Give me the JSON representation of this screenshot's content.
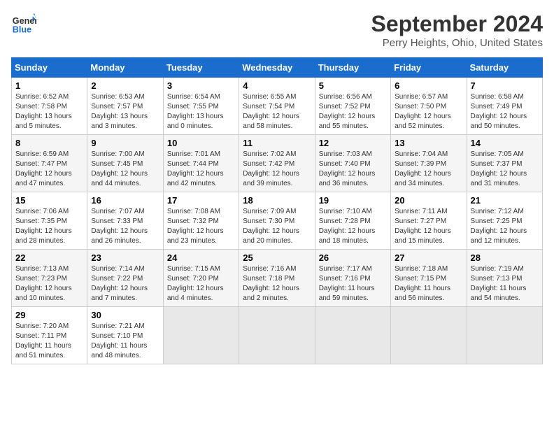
{
  "logo": {
    "line1": "General",
    "line2": "Blue"
  },
  "title": "September 2024",
  "subtitle": "Perry Heights, Ohio, United States",
  "days_of_week": [
    "Sunday",
    "Monday",
    "Tuesday",
    "Wednesday",
    "Thursday",
    "Friday",
    "Saturday"
  ],
  "weeks": [
    [
      {
        "day": 1,
        "sunrise": "6:52 AM",
        "sunset": "7:58 PM",
        "daylight": "13 hours and 5 minutes."
      },
      {
        "day": 2,
        "sunrise": "6:53 AM",
        "sunset": "7:57 PM",
        "daylight": "13 hours and 3 minutes."
      },
      {
        "day": 3,
        "sunrise": "6:54 AM",
        "sunset": "7:55 PM",
        "daylight": "13 hours and 0 minutes."
      },
      {
        "day": 4,
        "sunrise": "6:55 AM",
        "sunset": "7:54 PM",
        "daylight": "12 hours and 58 minutes."
      },
      {
        "day": 5,
        "sunrise": "6:56 AM",
        "sunset": "7:52 PM",
        "daylight": "12 hours and 55 minutes."
      },
      {
        "day": 6,
        "sunrise": "6:57 AM",
        "sunset": "7:50 PM",
        "daylight": "12 hours and 52 minutes."
      },
      {
        "day": 7,
        "sunrise": "6:58 AM",
        "sunset": "7:49 PM",
        "daylight": "12 hours and 50 minutes."
      }
    ],
    [
      {
        "day": 8,
        "sunrise": "6:59 AM",
        "sunset": "7:47 PM",
        "daylight": "12 hours and 47 minutes."
      },
      {
        "day": 9,
        "sunrise": "7:00 AM",
        "sunset": "7:45 PM",
        "daylight": "12 hours and 44 minutes."
      },
      {
        "day": 10,
        "sunrise": "7:01 AM",
        "sunset": "7:44 PM",
        "daylight": "12 hours and 42 minutes."
      },
      {
        "day": 11,
        "sunrise": "7:02 AM",
        "sunset": "7:42 PM",
        "daylight": "12 hours and 39 minutes."
      },
      {
        "day": 12,
        "sunrise": "7:03 AM",
        "sunset": "7:40 PM",
        "daylight": "12 hours and 36 minutes."
      },
      {
        "day": 13,
        "sunrise": "7:04 AM",
        "sunset": "7:39 PM",
        "daylight": "12 hours and 34 minutes."
      },
      {
        "day": 14,
        "sunrise": "7:05 AM",
        "sunset": "7:37 PM",
        "daylight": "12 hours and 31 minutes."
      }
    ],
    [
      {
        "day": 15,
        "sunrise": "7:06 AM",
        "sunset": "7:35 PM",
        "daylight": "12 hours and 28 minutes."
      },
      {
        "day": 16,
        "sunrise": "7:07 AM",
        "sunset": "7:33 PM",
        "daylight": "12 hours and 26 minutes."
      },
      {
        "day": 17,
        "sunrise": "7:08 AM",
        "sunset": "7:32 PM",
        "daylight": "12 hours and 23 minutes."
      },
      {
        "day": 18,
        "sunrise": "7:09 AM",
        "sunset": "7:30 PM",
        "daylight": "12 hours and 20 minutes."
      },
      {
        "day": 19,
        "sunrise": "7:10 AM",
        "sunset": "7:28 PM",
        "daylight": "12 hours and 18 minutes."
      },
      {
        "day": 20,
        "sunrise": "7:11 AM",
        "sunset": "7:27 PM",
        "daylight": "12 hours and 15 minutes."
      },
      {
        "day": 21,
        "sunrise": "7:12 AM",
        "sunset": "7:25 PM",
        "daylight": "12 hours and 12 minutes."
      }
    ],
    [
      {
        "day": 22,
        "sunrise": "7:13 AM",
        "sunset": "7:23 PM",
        "daylight": "12 hours and 10 minutes."
      },
      {
        "day": 23,
        "sunrise": "7:14 AM",
        "sunset": "7:22 PM",
        "daylight": "12 hours and 7 minutes."
      },
      {
        "day": 24,
        "sunrise": "7:15 AM",
        "sunset": "7:20 PM",
        "daylight": "12 hours and 4 minutes."
      },
      {
        "day": 25,
        "sunrise": "7:16 AM",
        "sunset": "7:18 PM",
        "daylight": "12 hours and 2 minutes."
      },
      {
        "day": 26,
        "sunrise": "7:17 AM",
        "sunset": "7:16 PM",
        "daylight": "11 hours and 59 minutes."
      },
      {
        "day": 27,
        "sunrise": "7:18 AM",
        "sunset": "7:15 PM",
        "daylight": "11 hours and 56 minutes."
      },
      {
        "day": 28,
        "sunrise": "7:19 AM",
        "sunset": "7:13 PM",
        "daylight": "11 hours and 54 minutes."
      }
    ],
    [
      {
        "day": 29,
        "sunrise": "7:20 AM",
        "sunset": "7:11 PM",
        "daylight": "11 hours and 51 minutes."
      },
      {
        "day": 30,
        "sunrise": "7:21 AM",
        "sunset": "7:10 PM",
        "daylight": "11 hours and 48 minutes."
      },
      null,
      null,
      null,
      null,
      null
    ]
  ]
}
